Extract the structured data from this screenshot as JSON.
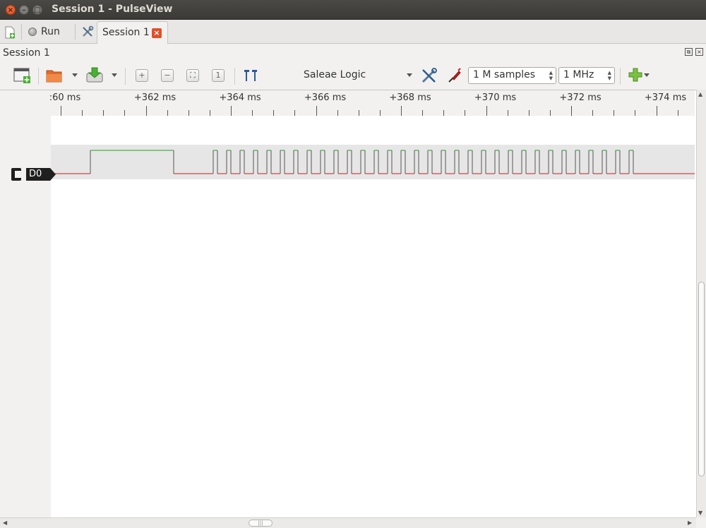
{
  "window": {
    "title": "Session 1 - PulseView",
    "close_glyph": "×",
    "min_glyph": "–",
    "max_glyph": "□"
  },
  "tabbar": {
    "run_label": "Run",
    "tab_label": "Session 1",
    "tab_close_glyph": "×"
  },
  "session": {
    "label": "Session 1"
  },
  "toolbar": {
    "device": "Saleae Logic",
    "samples": "1 M samples",
    "rate": "1 MHz"
  },
  "ruler": {
    "labels": [
      ":60 ms",
      "+362 ms",
      "+364 ms",
      "+366 ms",
      "+368 ms",
      "+370 ms",
      "+372 ms",
      "+374 ms"
    ]
  },
  "channel": {
    "name": "D0",
    "high_color": "#21a221",
    "low_color": "#c82020"
  }
}
